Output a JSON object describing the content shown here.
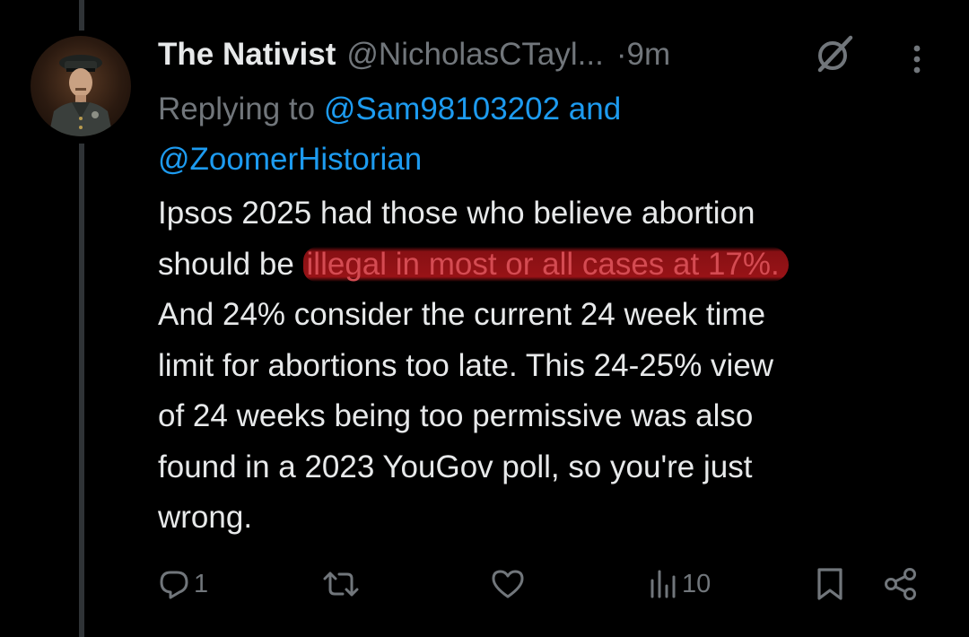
{
  "tweet": {
    "display_name": "The Nativist",
    "handle": "@NicholasCTayl...",
    "time": "9m",
    "dot": "·",
    "replying_prefix": "Replying to",
    "reply_mention_1": "@Sam98103202",
    "reply_and": "and",
    "reply_mention_2": "@ZoomerHistorian",
    "body_lines": [
      "Ipsos 2025 had those who believe abortion",
      "should be ",
      "illegal in most or all cases at 17%.",
      "And 24% consider the current 24 week time",
      "limit for abortions too late. This 24-25% view",
      "of 24 weeks being too permissive was also",
      "found in a 2023 YouGov poll, so you're just",
      "wrong."
    ]
  },
  "actions": {
    "reply_count": "1",
    "views_count": "10"
  },
  "icons": {
    "grok": "grok-icon",
    "more": "more-options-icon",
    "reply": "reply-icon",
    "retweet": "retweet-icon",
    "like": "heart-icon",
    "views": "views-icon",
    "bookmark": "bookmark-icon",
    "share": "share-icon"
  },
  "colors": {
    "background": "#000000",
    "text": "#e7e9ea",
    "muted": "#71767b",
    "link": "#1d9bf0",
    "highlight": "#a3171b",
    "thread_line": "#2f3336"
  }
}
